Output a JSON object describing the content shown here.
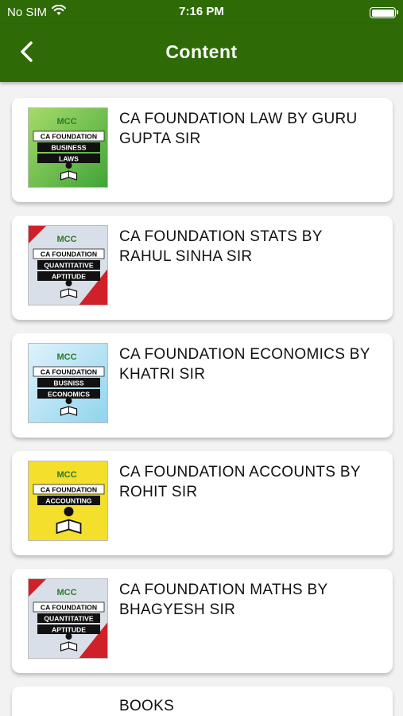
{
  "status": {
    "carrier": "No SIM",
    "time": "7:16 PM"
  },
  "header": {
    "title": "Content"
  },
  "items": [
    {
      "label": "CA FOUNDATION LAW BY GURU GUPTA SIR",
      "thumb_line1": "CA FOUNDATION",
      "thumb_line2": "BUSINESS",
      "thumb_line3": "LAWS",
      "theme": "green"
    },
    {
      "label": "CA FOUNDATION STATS BY RAHUL SINHA SIR",
      "thumb_line1": "CA FOUNDATION",
      "thumb_line2": "QUANTITATIVE",
      "thumb_line3": "APTITUDE",
      "theme": "red"
    },
    {
      "label": "CA FOUNDATION ECONOMICS BY KHATRI SIR",
      "thumb_line1": "CA FOUNDATION",
      "thumb_line2": "BUSNISS",
      "thumb_line3": "ECONOMICS",
      "theme": "blue"
    },
    {
      "label": "CA FOUNDATION ACCOUNTS BY ROHIT SIR",
      "thumb_line1": "CA FOUNDATION",
      "thumb_line2": "ACCOUNTING",
      "thumb_line3": "",
      "theme": "yellow"
    },
    {
      "label": "CA FOUNDATION MATHS BY BHAGYESH SIR",
      "thumb_line1": "CA FOUNDATION",
      "thumb_line2": "QUANTITATIVE",
      "thumb_line3": "APTITUDE",
      "theme": "red"
    },
    {
      "label": "BOOKS"
    }
  ],
  "thumb_logo": "MCC",
  "colors": {
    "nav": "#2e6b06",
    "green": "#3fa338",
    "red": "#d0212a",
    "blue": "#8fd3ee",
    "yellow": "#f4df2d"
  }
}
